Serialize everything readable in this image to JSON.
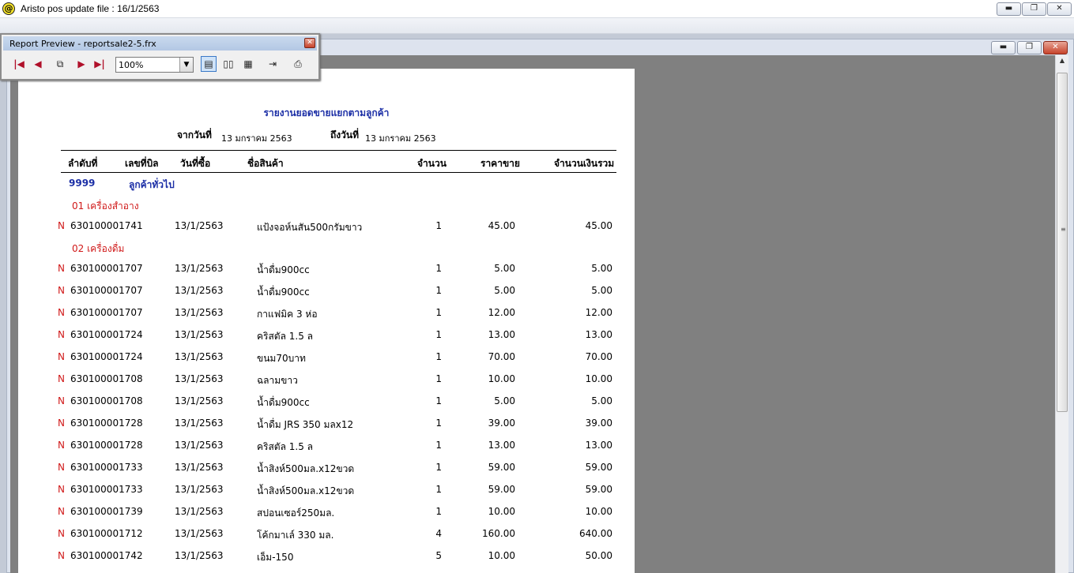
{
  "app": {
    "title": "Aristo pos  update file : 16/1/2563",
    "icon_glyph": "@"
  },
  "window_controls": {
    "minimize": "▬",
    "restore": "❐",
    "close": "✕"
  },
  "toolbar": {
    "title": "Report Preview - reportsale2-5.frx",
    "zoom": "100%",
    "icons": {
      "first": "|◀",
      "prev": "◀",
      "copies": "⧉",
      "next": "▶",
      "last": "▶|",
      "one_page": "▤",
      "two_pages": "▯▯",
      "four_pages": "▦",
      "exit": "⇥",
      "print": "⎙",
      "dropdown": "▼"
    }
  },
  "report": {
    "title": "รายงานยอดขายแยกตามลูกค้า",
    "from_label": "จากวันที่",
    "from_date": "13 มกราคม 2563",
    "to_label": "ถึงวันที่",
    "to_date": "13 มกราคม 2563",
    "columns": {
      "seq": "ลำดับที่",
      "bill": "เลขที่บิล",
      "date": "วันที่ซื้อ",
      "product": "ชื่อสินค้า",
      "qty": "จำนวน",
      "price": "ราคาขาย",
      "amount": "จำนวนเงินรวม"
    },
    "customer": {
      "code": "9999",
      "name": "ลูกค้าทั่วไป"
    },
    "groups": [
      {
        "label": "01 เครื่องสำอาง",
        "rows": [
          {
            "flag": "N",
            "bill": "630100001741",
            "date": "13/1/2563",
            "product": "แป้งจอห์นสัน500กรัมขาว",
            "qty": "1",
            "price": "45.00",
            "amount": "45.00"
          }
        ]
      },
      {
        "label": "02 เครื่องดื่ม",
        "rows": [
          {
            "flag": "N",
            "bill": "630100001707",
            "date": "13/1/2563",
            "product": "น้ำดื่ม900cc",
            "qty": "1",
            "price": "5.00",
            "amount": "5.00"
          },
          {
            "flag": "N",
            "bill": "630100001707",
            "date": "13/1/2563",
            "product": "น้ำดื่ม900cc",
            "qty": "1",
            "price": "5.00",
            "amount": "5.00"
          },
          {
            "flag": "N",
            "bill": "630100001707",
            "date": "13/1/2563",
            "product": "กาแฟมิค 3 ห่อ",
            "qty": "1",
            "price": "12.00",
            "amount": "12.00"
          },
          {
            "flag": "N",
            "bill": "630100001724",
            "date": "13/1/2563",
            "product": "คริสตัล 1.5 ล",
            "qty": "1",
            "price": "13.00",
            "amount": "13.00"
          },
          {
            "flag": "N",
            "bill": "630100001724",
            "date": "13/1/2563",
            "product": "ขนม70บาท",
            "qty": "1",
            "price": "70.00",
            "amount": "70.00"
          },
          {
            "flag": "N",
            "bill": "630100001708",
            "date": "13/1/2563",
            "product": "ฉลามขาว",
            "qty": "1",
            "price": "10.00",
            "amount": "10.00"
          },
          {
            "flag": "N",
            "bill": "630100001708",
            "date": "13/1/2563",
            "product": "น้ำดื่ม900cc",
            "qty": "1",
            "price": "5.00",
            "amount": "5.00"
          },
          {
            "flag": "N",
            "bill": "630100001728",
            "date": "13/1/2563",
            "product": "น้ำดื่ม JRS 350 มลx12",
            "qty": "1",
            "price": "39.00",
            "amount": "39.00"
          },
          {
            "flag": "N",
            "bill": "630100001728",
            "date": "13/1/2563",
            "product": "คริสตัล 1.5 ล",
            "qty": "1",
            "price": "13.00",
            "amount": "13.00"
          },
          {
            "flag": "N",
            "bill": "630100001733",
            "date": "13/1/2563",
            "product": "น้ำสิงห์500มล.x12ขวด",
            "qty": "1",
            "price": "59.00",
            "amount": "59.00"
          },
          {
            "flag": "N",
            "bill": "630100001733",
            "date": "13/1/2563",
            "product": "น้ำสิงห์500มล.x12ขวด",
            "qty": "1",
            "price": "59.00",
            "amount": "59.00"
          },
          {
            "flag": "N",
            "bill": "630100001739",
            "date": "13/1/2563",
            "product": "สปอนเซอร์250มล.",
            "qty": "1",
            "price": "10.00",
            "amount": "10.00"
          },
          {
            "flag": "N",
            "bill": "630100001712",
            "date": "13/1/2563",
            "product": "โค้กมาเล์ 330 มล.",
            "qty": "4",
            "price": "160.00",
            "amount": "640.00"
          },
          {
            "flag": "N",
            "bill": "630100001742",
            "date": "13/1/2563",
            "product": "เอ็ม-150",
            "qty": "5",
            "price": "10.00",
            "amount": "50.00"
          }
        ]
      }
    ]
  }
}
